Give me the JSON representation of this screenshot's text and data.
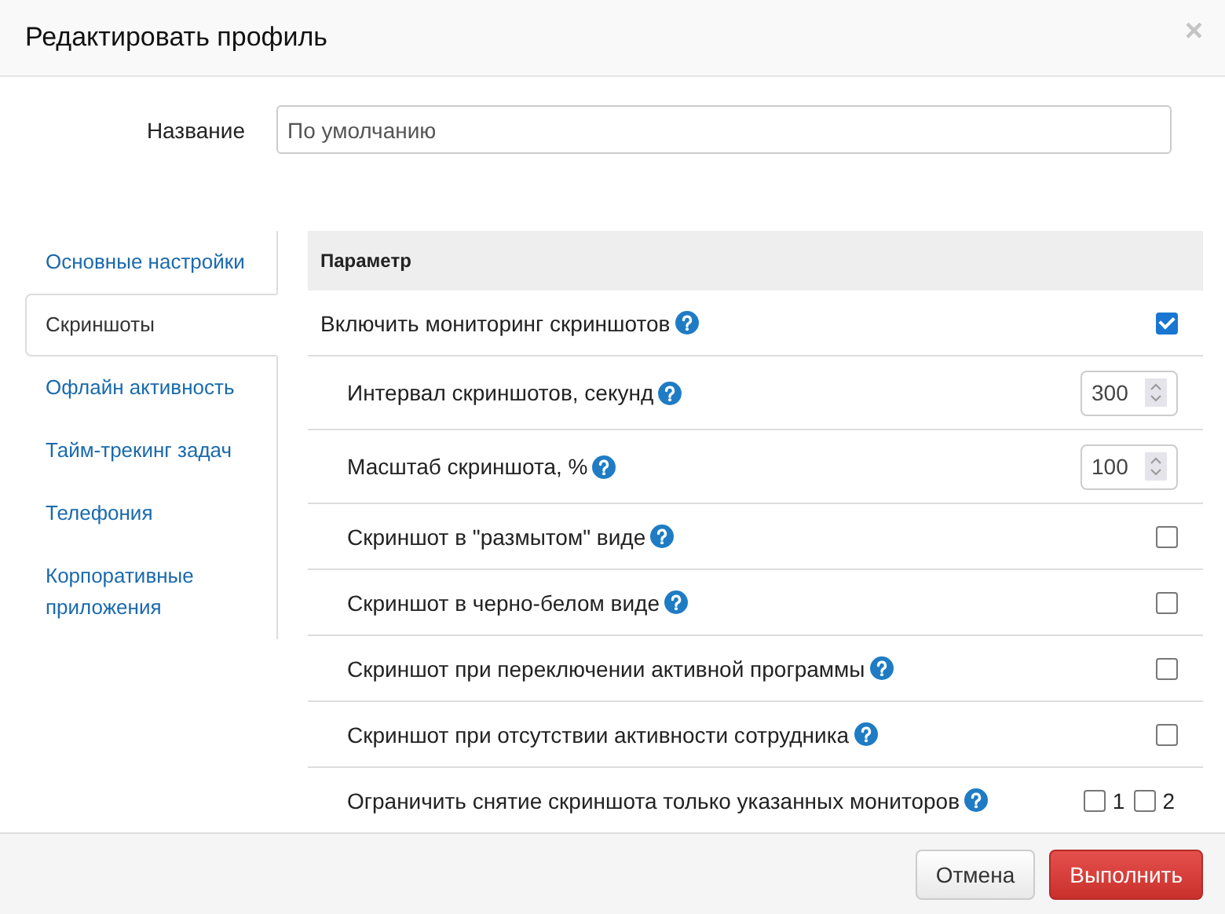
{
  "dialog": {
    "title": "Редактировать профиль",
    "close": "×"
  },
  "name_field": {
    "label": "Название",
    "value": "По умолчанию"
  },
  "tabs": [
    {
      "label": "Основные настройки",
      "selected": false
    },
    {
      "label": "Скриншоты",
      "selected": true
    },
    {
      "label": "Офлайн активность",
      "selected": false
    },
    {
      "label": "Тайм-трекинг задач",
      "selected": false
    },
    {
      "label": "Телефония",
      "selected": false
    },
    {
      "label": "Корпоративные приложения",
      "selected": false
    }
  ],
  "table": {
    "header": "Параметр",
    "rows": [
      {
        "kind": "checkbox",
        "label": "Включить мониторинг скриншотов",
        "checked": true,
        "children": [
          {
            "kind": "number",
            "label": "Интервал скриншотов, секунд",
            "value": "300"
          },
          {
            "kind": "number",
            "label": "Масштаб скриншота, %",
            "value": "100"
          },
          {
            "kind": "checkbox",
            "label": "Скриншот в \"размытом\" виде",
            "checked": false
          },
          {
            "kind": "checkbox",
            "label": "Скриншот в черно-белом виде",
            "checked": false
          },
          {
            "kind": "checkbox",
            "label": "Скриншот при переключении активной программы",
            "checked": false
          },
          {
            "kind": "checkbox",
            "label": "Скриншот при отсутствии активности сотрудника",
            "checked": false
          },
          {
            "kind": "monitors",
            "label": "Ограничить снятие скриншота только указанных мониторов",
            "monitors": [
              {
                "label": "1",
                "checked": false
              },
              {
                "label": "2",
                "checked": false
              }
            ]
          }
        ]
      }
    ]
  },
  "buttons": {
    "cancel": "Отмена",
    "submit": "Выполнить"
  }
}
